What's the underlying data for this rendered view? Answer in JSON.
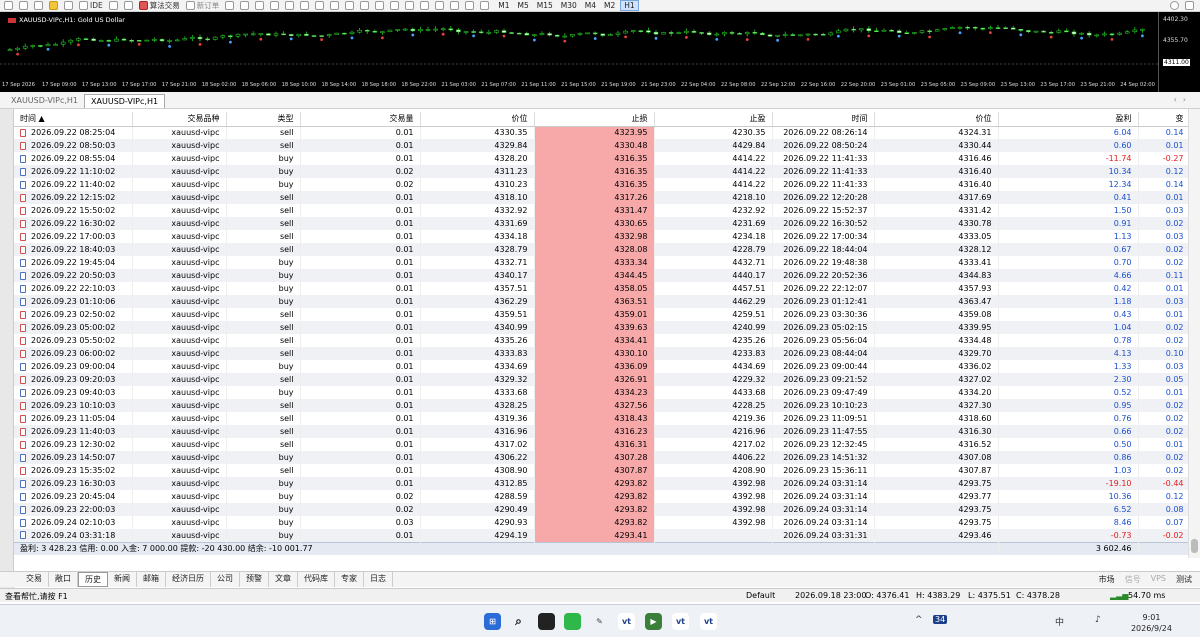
{
  "toolbar": {
    "algo_label": "算法交易",
    "new_order_label": "新订单",
    "ide_label": "IDE",
    "periods": [
      "M1",
      "M5",
      "M15",
      "M30",
      "M4",
      "M2",
      "H1"
    ],
    "active_period": "H1"
  },
  "chart": {
    "title": "XAUUSD-VIPc,H1:  Gold US Dollar",
    "price_levels": [
      "4402.30",
      "4355.70",
      "4311.00"
    ],
    "price_current": "4311.00",
    "x_ticks": [
      "17 Sep 2026",
      "17 Sep 09:00",
      "17 Sep 13:00",
      "17 Sep 17:00",
      "17 Sep 21:00",
      "18 Sep 02:00",
      "18 Sep 06:00",
      "18 Sep 10:00",
      "18 Sep 14:00",
      "18 Sep 18:00",
      "18 Sep 22:00",
      "21 Sep 03:00",
      "21 Sep 07:00",
      "21 Sep 11:00",
      "21 Sep 15:00",
      "21 Sep 19:00",
      "21 Sep 23:00",
      "22 Sep 04:00",
      "22 Sep 08:00",
      "22 Sep 12:00",
      "22 Sep 16:00",
      "22 Sep 20:00",
      "23 Sep 01:00",
      "23 Sep 05:00",
      "23 Sep 09:00",
      "23 Sep 13:00",
      "23 Sep 17:00",
      "23 Sep 21:00",
      "24 Sep 02:00"
    ]
  },
  "chart_tabs": [
    "XAUUSD-VIPc,H1",
    "XAUUSD-VIPc,H1"
  ],
  "history": {
    "columns": [
      "时间",
      "交易品种",
      "类型",
      "交易量",
      "价位",
      "止损",
      "止盈",
      "时间",
      "价位",
      "盈利",
      "变"
    ],
    "rows": [
      [
        "2026.09.22 08:25:04",
        "xauusd-vipc",
        "sell",
        "0.01",
        "4330.35",
        "4323.95",
        "4230.35",
        "2026.09.22 08:26:14",
        "4324.31",
        "6.04",
        "0.14"
      ],
      [
        "2026.09.22 08:50:03",
        "xauusd-vipc",
        "sell",
        "0.01",
        "4329.84",
        "4330.48",
        "4429.84",
        "2026.09.22 08:50:24",
        "4330.44",
        "0.60",
        "0.01"
      ],
      [
        "2026.09.22 08:55:04",
        "xauusd-vipc",
        "buy",
        "0.01",
        "4328.20",
        "4316.35",
        "4414.22",
        "2026.09.22 11:41:33",
        "4316.46",
        "-11.74",
        "-0.27"
      ],
      [
        "2026.09.22 11:10:02",
        "xauusd-vipc",
        "buy",
        "0.02",
        "4311.23",
        "4316.35",
        "4414.22",
        "2026.09.22 11:41:33",
        "4316.40",
        "10.34",
        "0.12"
      ],
      [
        "2026.09.22 11:40:02",
        "xauusd-vipc",
        "buy",
        "0.02",
        "4310.23",
        "4316.35",
        "4414.22",
        "2026.09.22 11:41:33",
        "4316.40",
        "12.34",
        "0.14"
      ],
      [
        "2026.09.22 12:15:02",
        "xauusd-vipc",
        "sell",
        "0.01",
        "4318.10",
        "4317.26",
        "4218.10",
        "2026.09.22 12:20:28",
        "4317.69",
        "0.41",
        "0.01"
      ],
      [
        "2026.09.22 15:50:02",
        "xauusd-vipc",
        "sell",
        "0.01",
        "4332.92",
        "4331.47",
        "4232.92",
        "2026.09.22 15:52:37",
        "4331.42",
        "1.50",
        "0.03"
      ],
      [
        "2026.09.22 16:30:02",
        "xauusd-vipc",
        "sell",
        "0.01",
        "4331.69",
        "4330.65",
        "4231.69",
        "2026.09.22 16:30:52",
        "4330.78",
        "0.91",
        "0.02"
      ],
      [
        "2026.09.22 17:00:03",
        "xauusd-vipc",
        "sell",
        "0.01",
        "4334.18",
        "4332.98",
        "4234.18",
        "2026.09.22 17:00:34",
        "4333.05",
        "1.13",
        "0.03"
      ],
      [
        "2026.09.22 18:40:03",
        "xauusd-vipc",
        "sell",
        "0.01",
        "4328.79",
        "4328.08",
        "4228.79",
        "2026.09.22 18:44:04",
        "4328.12",
        "0.67",
        "0.02"
      ],
      [
        "2026.09.22 19:45:04",
        "xauusd-vipc",
        "buy",
        "0.01",
        "4332.71",
        "4333.34",
        "4432.71",
        "2026.09.22 19:48:38",
        "4333.41",
        "0.70",
        "0.02"
      ],
      [
        "2026.09.22 20:50:03",
        "xauusd-vipc",
        "buy",
        "0.01",
        "4340.17",
        "4344.45",
        "4440.17",
        "2026.09.22 20:52:36",
        "4344.83",
        "4.66",
        "0.11"
      ],
      [
        "2026.09.22 22:10:03",
        "xauusd-vipc",
        "buy",
        "0.01",
        "4357.51",
        "4358.05",
        "4457.51",
        "2026.09.22 22:12:07",
        "4357.93",
        "0.42",
        "0.01"
      ],
      [
        "2026.09.23 01:10:06",
        "xauusd-vipc",
        "buy",
        "0.01",
        "4362.29",
        "4363.51",
        "4462.29",
        "2026.09.23 01:12:41",
        "4363.47",
        "1.18",
        "0.03"
      ],
      [
        "2026.09.23 02:50:02",
        "xauusd-vipc",
        "sell",
        "0.01",
        "4359.51",
        "4359.01",
        "4259.51",
        "2026.09.23 03:30:36",
        "4359.08",
        "0.43",
        "0.01"
      ],
      [
        "2026.09.23 05:00:02",
        "xauusd-vipc",
        "sell",
        "0.01",
        "4340.99",
        "4339.63",
        "4240.99",
        "2026.09.23 05:02:15",
        "4339.95",
        "1.04",
        "0.02"
      ],
      [
        "2026.09.23 05:50:02",
        "xauusd-vipc",
        "sell",
        "0.01",
        "4335.26",
        "4334.41",
        "4235.26",
        "2026.09.23 05:56:04",
        "4334.48",
        "0.78",
        "0.02"
      ],
      [
        "2026.09.23 06:00:02",
        "xauusd-vipc",
        "sell",
        "0.01",
        "4333.83",
        "4330.10",
        "4233.83",
        "2026.09.23 08:44:04",
        "4329.70",
        "4.13",
        "0.10"
      ],
      [
        "2026.09.23 09:00:04",
        "xauusd-vipc",
        "buy",
        "0.01",
        "4334.69",
        "4336.09",
        "4434.69",
        "2026.09.23 09:00:44",
        "4336.02",
        "1.33",
        "0.03"
      ],
      [
        "2026.09.23 09:20:03",
        "xauusd-vipc",
        "sell",
        "0.01",
        "4329.32",
        "4326.91",
        "4229.32",
        "2026.09.23 09:21:52",
        "4327.02",
        "2.30",
        "0.05"
      ],
      [
        "2026.09.23 09:40:03",
        "xauusd-vipc",
        "buy",
        "0.01",
        "4333.68",
        "4334.23",
        "4433.68",
        "2026.09.23 09:47:49",
        "4334.20",
        "0.52",
        "0.01"
      ],
      [
        "2026.09.23 10:10:03",
        "xauusd-vipc",
        "sell",
        "0.01",
        "4328.25",
        "4327.56",
        "4228.25",
        "2026.09.23 10:10:23",
        "4327.30",
        "0.95",
        "0.02"
      ],
      [
        "2026.09.23 11:05:04",
        "xauusd-vipc",
        "sell",
        "0.01",
        "4319.36",
        "4318.43",
        "4219.36",
        "2026.09.23 11:09:51",
        "4318.60",
        "0.76",
        "0.02"
      ],
      [
        "2026.09.23 11:40:03",
        "xauusd-vipc",
        "sell",
        "0.01",
        "4316.96",
        "4316.23",
        "4216.96",
        "2026.09.23 11:47:55",
        "4316.30",
        "0.66",
        "0.02"
      ],
      [
        "2026.09.23 12:30:02",
        "xauusd-vipc",
        "sell",
        "0.01",
        "4317.02",
        "4316.31",
        "4217.02",
        "2026.09.23 12:32:45",
        "4316.52",
        "0.50",
        "0.01"
      ],
      [
        "2026.09.23 14:50:07",
        "xauusd-vipc",
        "buy",
        "0.01",
        "4306.22",
        "4307.28",
        "4406.22",
        "2026.09.23 14:51:32",
        "4307.08",
        "0.86",
        "0.02"
      ],
      [
        "2026.09.23 15:35:02",
        "xauusd-vipc",
        "sell",
        "0.01",
        "4308.90",
        "4307.87",
        "4208.90",
        "2026.09.23 15:36:11",
        "4307.87",
        "1.03",
        "0.02"
      ],
      [
        "2026.09.23 16:30:03",
        "xauusd-vipc",
        "buy",
        "0.01",
        "4312.85",
        "4293.82",
        "4392.98",
        "2026.09.24 03:31:14",
        "4293.75",
        "-19.10",
        "-0.44"
      ],
      [
        "2026.09.23 20:45:04",
        "xauusd-vipc",
        "buy",
        "0.02",
        "4288.59",
        "4293.82",
        "4392.98",
        "2026.09.24 03:31:14",
        "4293.77",
        "10.36",
        "0.12"
      ],
      [
        "2026.09.23 22:00:03",
        "xauusd-vipc",
        "buy",
        "0.02",
        "4290.49",
        "4293.82",
        "4392.98",
        "2026.09.24 03:31:14",
        "4293.75",
        "6.52",
        "0.08"
      ],
      [
        "2026.09.24 02:10:03",
        "xauusd-vipc",
        "buy",
        "0.03",
        "4290.93",
        "4293.82",
        "4392.98",
        "2026.09.24 03:31:14",
        "4293.75",
        "8.46",
        "0.07"
      ],
      [
        "2026.09.24 03:31:18",
        "xauusd-vipc",
        "buy",
        "0.01",
        "4294.19",
        "4293.41",
        "",
        "2026.09.24 03:31:31",
        "4293.46",
        "-0.73",
        "-0.02"
      ]
    ],
    "totals_text": "盈利: 3 428.23  信用: 0.00  入金: 7 000.00  提款: -20 430.00  结余: -10 001.77",
    "totals_profit": "3 602.46"
  },
  "bottom_tabs": [
    "交易",
    "敞口",
    "历史",
    "新闻",
    "邮箱",
    "经济日历",
    "公司",
    "预警",
    "文章",
    "代码库",
    "专家",
    "日志"
  ],
  "active_bottom_tab": "历史",
  "bottom_right": {
    "market": "市场",
    "signals": "信号",
    "vps": "VPS",
    "tester": "测试"
  },
  "status": {
    "help": "查看帮忙,请按 F1",
    "profile": "Default",
    "time": "2026.09.18 23:00",
    "open": "O: 4376.41",
    "high": "H: 4383.29",
    "low": "L: 4375.51",
    "close": "C: 4378.28",
    "ping": "54.70 ms"
  },
  "taskbar": {
    "time": "9:01",
    "date": "2026/9/24",
    "ime": "中",
    "badge": "34"
  },
  "colors": {
    "stoploss_bg": "#f7a9a9",
    "profit": "#1a4fcc",
    "loss": "#e02020",
    "alt_row": "#f0f1f5"
  }
}
